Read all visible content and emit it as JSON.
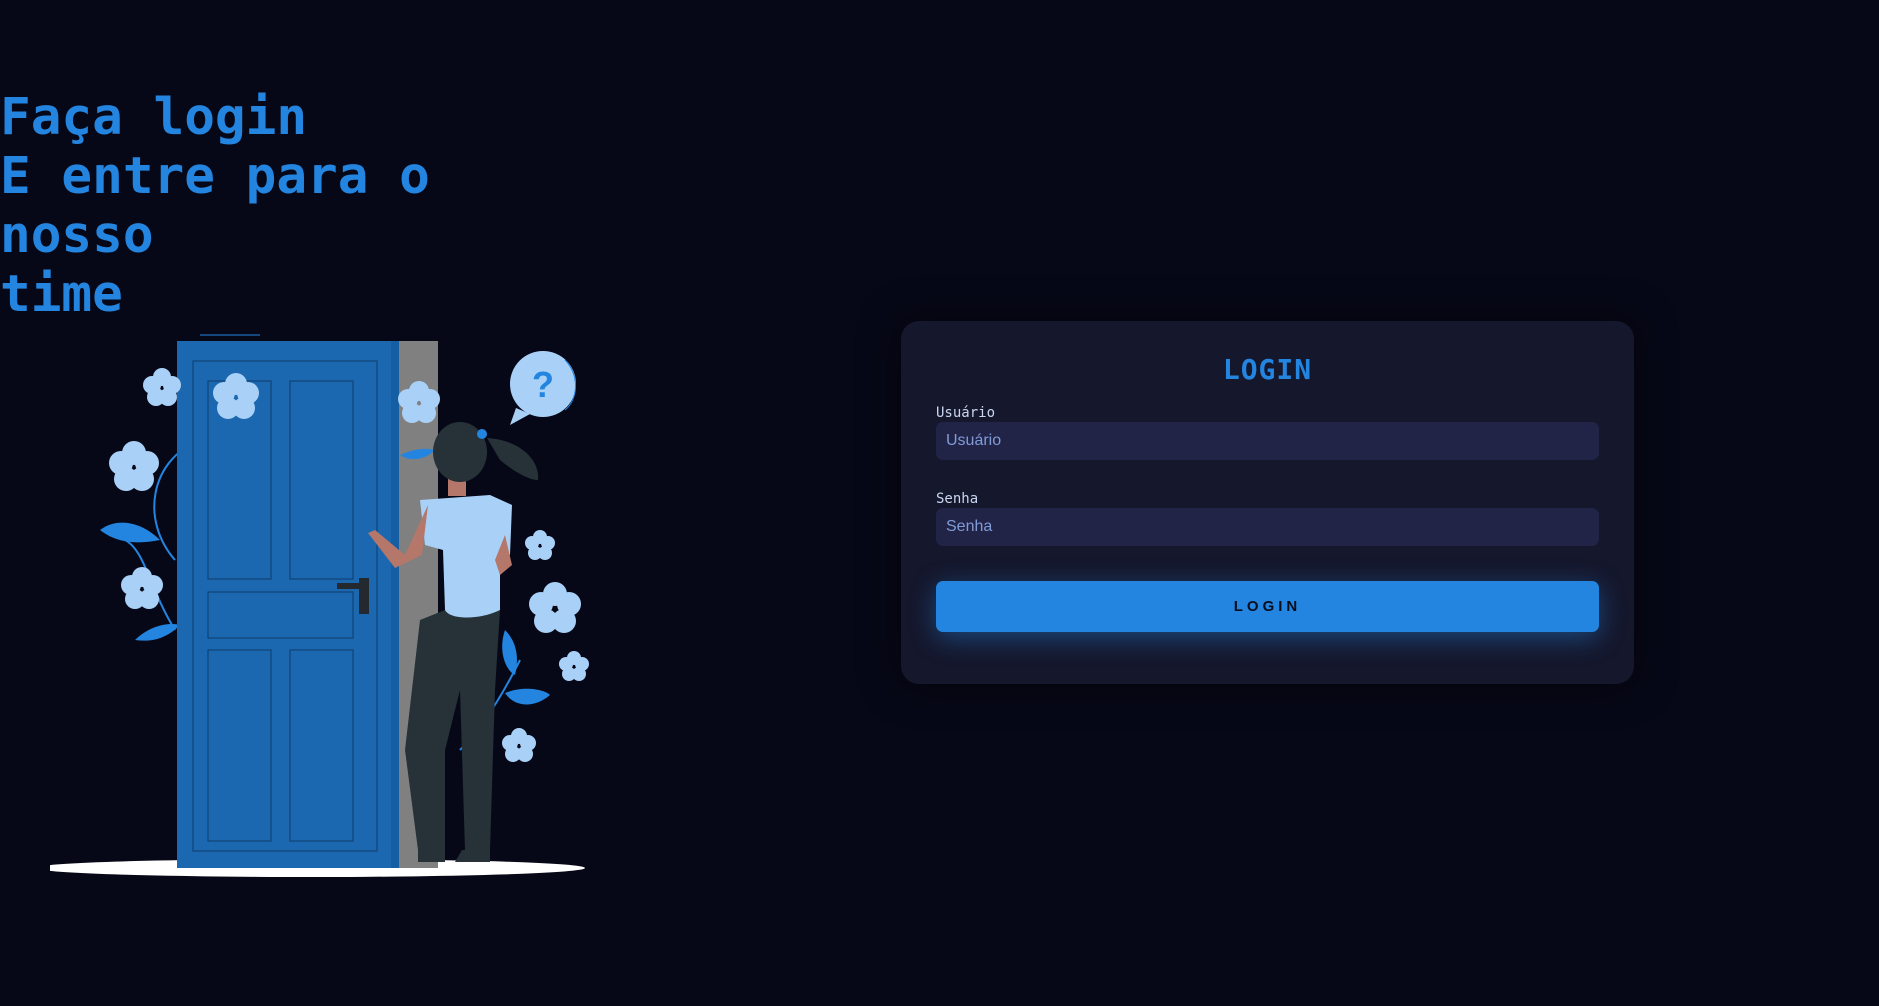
{
  "hero": {
    "line1": "Faça login",
    "line2": "E entre para o nosso",
    "line3": "time"
  },
  "illustration": {
    "icon": "question-mark-bubble",
    "glyph": "?"
  },
  "login_form": {
    "title": "LOGIN",
    "username": {
      "label": "Usuário",
      "placeholder": "Usuário",
      "value": ""
    },
    "password": {
      "label": "Senha",
      "placeholder": "Senha",
      "value": ""
    },
    "submit_label": "LOGIN"
  },
  "colors": {
    "background": "#070817",
    "accent": "#2385e0",
    "card": "#15172c",
    "input": "#222447"
  }
}
